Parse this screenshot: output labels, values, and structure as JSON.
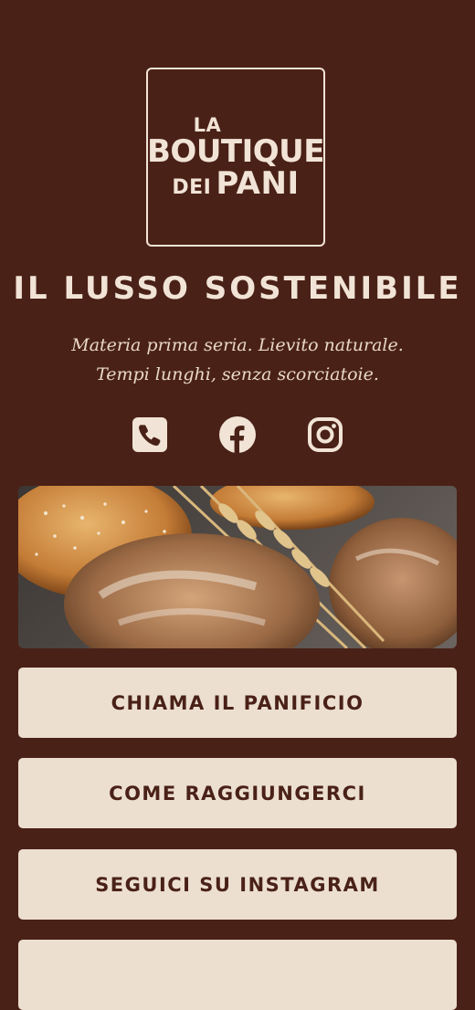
{
  "logo": {
    "line1": "LA",
    "line2": "BOUTIQUE",
    "line3a": "DEI",
    "line3b": "PANI"
  },
  "title": "IL LUSSO SOSTENIBILE",
  "subtitle": {
    "line1": "Materia prima seria. Lievito naturale.",
    "line2": "Tempi lunghi, senza scorciatoie."
  },
  "social_icons": [
    "phone-icon",
    "facebook-icon",
    "instagram-icon"
  ],
  "hero_image": "bread-and-wheat-photo",
  "buttons": {
    "call": "CHIAMA IL PANIFICIO",
    "directions": "COME RAGGIUNGERCI",
    "instagram": "SEGUICI SU INSTAGRAM",
    "more": ""
  },
  "colors": {
    "background": "#4a2117",
    "button_bg": "#ecdfd0",
    "text_light": "#f1e4d6"
  }
}
